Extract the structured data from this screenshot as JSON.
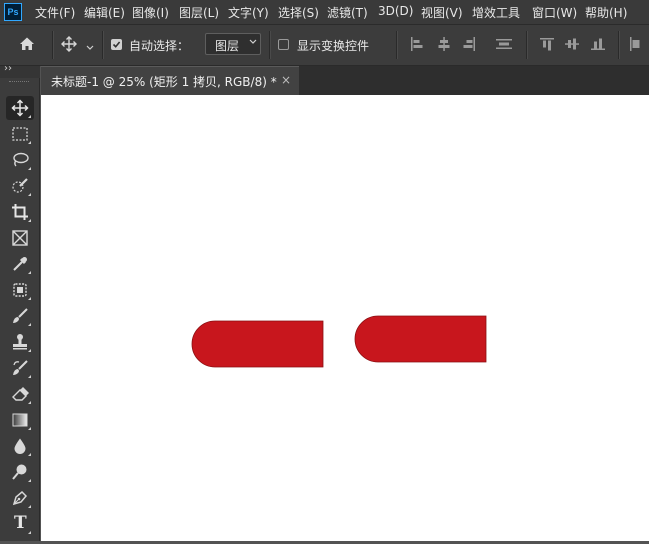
{
  "app": {
    "logo": "Ps"
  },
  "menu": {
    "items": [
      {
        "label": "文件(F)"
      },
      {
        "label": "编辑(E)"
      },
      {
        "label": "图像(I)"
      },
      {
        "label": "图层(L)"
      },
      {
        "label": "文字(Y)"
      },
      {
        "label": "选择(S)"
      },
      {
        "label": "滤镜(T)"
      },
      {
        "label": "3D(D)"
      },
      {
        "label": "视图(V)"
      },
      {
        "label": "增效工具"
      },
      {
        "label": "窗口(W)"
      },
      {
        "label": "帮助(H)"
      }
    ]
  },
  "options": {
    "auto_select_label": "自动选择：",
    "auto_select_checked": true,
    "auto_select_target": "图层",
    "show_transform_label": "显示变换控件",
    "show_transform_checked": false
  },
  "document": {
    "tab_title": "未标题-1 @ 25% (矩形 1 拷贝, RGB/8) *",
    "close_glyph": "×"
  },
  "tools_collapse_glyph": "››",
  "tools": [
    {
      "name": "move-tool",
      "active": true
    },
    {
      "name": "marquee-tool"
    },
    {
      "name": "lasso-tool"
    },
    {
      "name": "quick-select-tool"
    },
    {
      "name": "crop-tool"
    },
    {
      "name": "frame-tool"
    },
    {
      "name": "eyedropper-tool"
    },
    {
      "name": "healing-brush-tool"
    },
    {
      "name": "brush-tool"
    },
    {
      "name": "clone-stamp-tool"
    },
    {
      "name": "history-brush-tool"
    },
    {
      "name": "eraser-tool"
    },
    {
      "name": "gradient-tool"
    },
    {
      "name": "blur-tool"
    },
    {
      "name": "dodge-tool"
    },
    {
      "name": "pen-tool"
    },
    {
      "name": "type-tool",
      "glyph": "T"
    }
  ],
  "colors": {
    "shape_fill": "#c8161d",
    "shape_stroke": "#8a0f12",
    "canvas": "#ffffff",
    "menubar": "#3a3a3a",
    "panel": "#3c3c3c"
  }
}
